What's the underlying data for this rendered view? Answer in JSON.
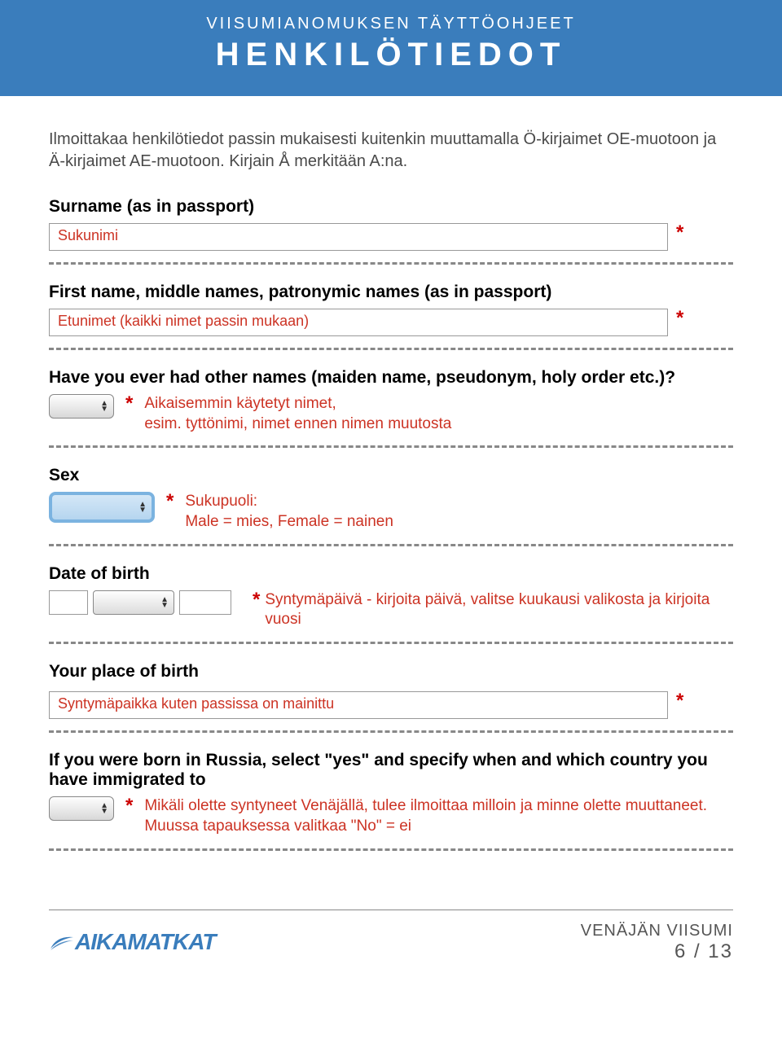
{
  "header": {
    "subtitle": "VIISUMIANOMUKSEN TÄYTTÖOHJEET",
    "title": "HENKILÖTIEDOT"
  },
  "intro": "Ilmoittakaa henkilötiedot passin mukaisesti kuitenkin muuttamalla Ö-kirjaimet OE-muotoon ja Ä-kirjaimet AE-muotoon. Kirjain Å merkitään A:na.",
  "fields": {
    "surname": {
      "label": "Surname (as in passport)",
      "value": "Sukunimi"
    },
    "firstname": {
      "label": "First name, middle names, patronymic names (as in passport)",
      "value": "Etunimet (kaikki nimet passin mukaan)"
    },
    "othernames": {
      "label": "Have you ever had other names (maiden name, pseudonym, holy order etc.)?",
      "help": "Aikaisemmin käytetyt nimet,\nesim. tyttönimi, nimet ennen nimen muutosta"
    },
    "sex": {
      "label": "Sex",
      "help": "Sukupuoli:\nMale = mies, Female = nainen"
    },
    "dob": {
      "label": "Date of birth",
      "help": "Syntymäpäivä - kirjoita päivä, valitse kuukausi valikosta ja kirjoita vuosi"
    },
    "pob": {
      "label": "Your place of birth",
      "value": "Syntymäpaikka kuten passissa on mainittu"
    },
    "born_russia": {
      "label": "If you were born in Russia, select \"yes\" and specify when and which country you have immigrated to",
      "help": "Mikäli olette syntyneet Venäjällä, tulee ilmoittaa milloin ja minne olette muuttaneet. Muussa tapauksessa valitkaa \"No\" = ei"
    }
  },
  "footer": {
    "logo": "AIKAMATKAT",
    "doc_title": "VENÄJÄN VIISUMI",
    "page": "6 / 13"
  },
  "asterisk": "*"
}
